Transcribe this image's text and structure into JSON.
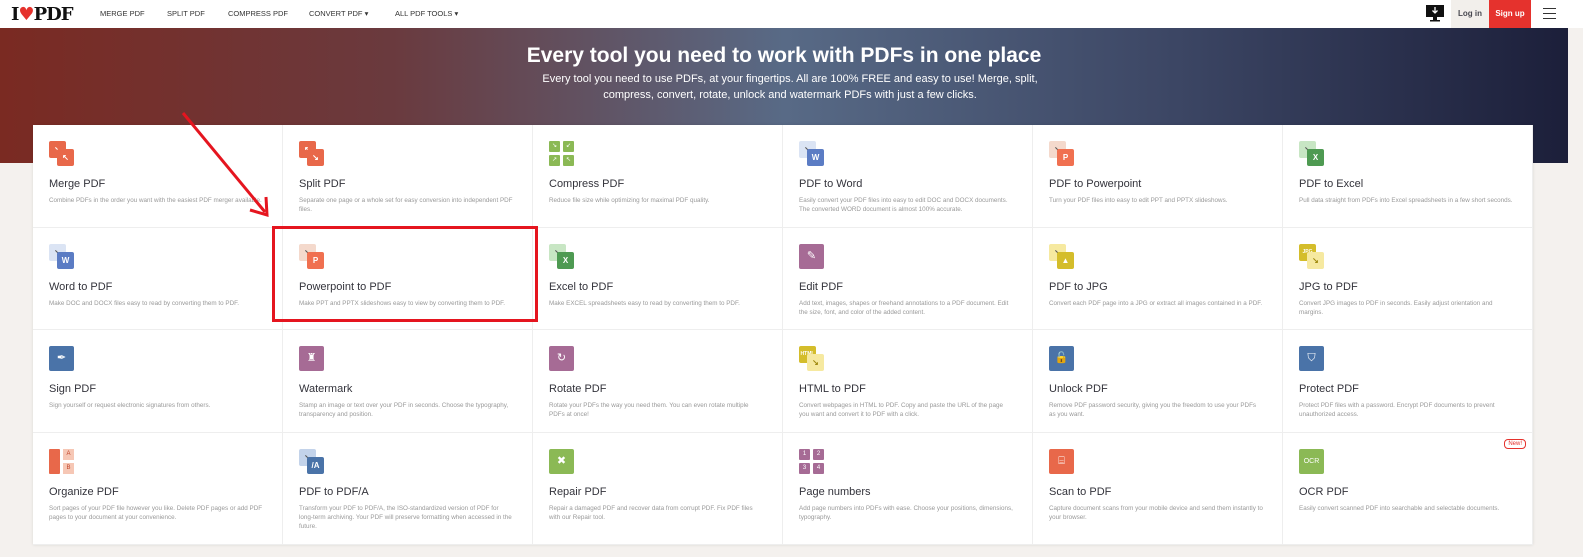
{
  "header": {
    "logo": "I♥PDF",
    "nav": [
      "MERGE PDF",
      "SPLIT PDF",
      "COMPRESS PDF",
      "CONVERT PDF ▾",
      "ALL PDF TOOLS ▾"
    ],
    "login": "Log in",
    "signup": "Sign up"
  },
  "hero": {
    "title": "Every tool you need to work with PDFs in one place",
    "subtitle": "Every tool you need to use PDFs, at your fingertips. All are 100% FREE and easy to use! Merge, split, compress, convert, rotate, unlock and watermark PDFs with just a few clicks."
  },
  "colors": {
    "accent": "#e5322d",
    "orange": "#e8684a",
    "green": "#8bb955",
    "blue": "#4a73a8",
    "purple": "#a66b95",
    "yellow": "#d9c233"
  },
  "tools": [
    {
      "title": "Merge PDF",
      "desc": "Combine PDFs in the order you want with the easiest PDF merger available.",
      "icon": "merge-icon"
    },
    {
      "title": "Split PDF",
      "desc": "Separate one page or a whole set for easy conversion into independent PDF files.",
      "icon": "split-icon"
    },
    {
      "title": "Compress PDF",
      "desc": "Reduce file size while optimizing for maximal PDF quality.",
      "icon": "compress-icon"
    },
    {
      "title": "PDF to Word",
      "desc": "Easily convert your PDF files into easy to edit DOC and DOCX documents. The converted WORD document is almost 100% accurate.",
      "icon": "word-icon",
      "glyph": "W"
    },
    {
      "title": "PDF to Powerpoint",
      "desc": "Turn your PDF files into easy to edit PPT and PPTX slideshows.",
      "icon": "powerpoint-icon",
      "glyph": "P"
    },
    {
      "title": "PDF to Excel",
      "desc": "Pull data straight from PDFs into Excel spreadsheets in a few short seconds.",
      "icon": "excel-icon",
      "glyph": "X"
    },
    {
      "title": "Word to PDF",
      "desc": "Make DOC and DOCX files easy to read by converting them to PDF.",
      "icon": "word-icon",
      "glyph": "W"
    },
    {
      "title": "Powerpoint to PDF",
      "desc": "Make PPT and PPTX slideshows easy to view by converting them to PDF.",
      "icon": "powerpoint-icon",
      "glyph": "P"
    },
    {
      "title": "Excel to PDF",
      "desc": "Make EXCEL spreadsheets easy to read by converting them to PDF.",
      "icon": "excel-icon",
      "glyph": "X"
    },
    {
      "title": "Edit PDF",
      "desc": "Add text, images, shapes or freehand annotations to a PDF document. Edit the size, font, and color of the added content.",
      "icon": "edit-icon",
      "glyph": "✎"
    },
    {
      "title": "PDF to JPG",
      "desc": "Convert each PDF page into a JPG or extract all images contained in a PDF.",
      "icon": "image-icon",
      "glyph": "▲"
    },
    {
      "title": "JPG to PDF",
      "desc": "Convert JPG images to PDF in seconds. Easily adjust orientation and margins.",
      "icon": "jpg-icon",
      "glyph": "JPG"
    },
    {
      "title": "Sign PDF",
      "desc": "Sign yourself or request electronic signatures from others.",
      "icon": "pen-icon",
      "glyph": "✒"
    },
    {
      "title": "Watermark",
      "desc": "Stamp an image or text over your PDF in seconds. Choose the typography, transparency and position.",
      "icon": "stamp-icon",
      "glyph": "♜"
    },
    {
      "title": "Rotate PDF",
      "desc": "Rotate your PDFs the way you need them. You can even rotate multiple PDFs at once!",
      "icon": "rotate-icon",
      "glyph": "↻"
    },
    {
      "title": "HTML to PDF",
      "desc": "Convert webpages in HTML to PDF. Copy and paste the URL of the page you want and convert it to PDF with a click.",
      "icon": "html-icon",
      "glyph": "HTML"
    },
    {
      "title": "Unlock PDF",
      "desc": "Remove PDF password security, giving you the freedom to use your PDFs as you want.",
      "icon": "unlock-icon",
      "glyph": "🔓"
    },
    {
      "title": "Protect PDF",
      "desc": "Protect PDF files with a password. Encrypt PDF documents to prevent unauthorized access.",
      "icon": "shield-icon",
      "glyph": "⛉"
    },
    {
      "title": "Organize PDF",
      "desc": "Sort pages of your PDF file however you like. Delete PDF pages or add PDF pages to your document at your convenience.",
      "icon": "organize-icon"
    },
    {
      "title": "PDF to PDF/A",
      "desc": "Transform your PDF to PDF/A, the ISO-standardized version of PDF for long-term archiving. Your PDF will preserve formatting when accessed in the future.",
      "icon": "pdfa-icon",
      "glyph": "/A"
    },
    {
      "title": "Repair PDF",
      "desc": "Repair a damaged PDF and recover data from corrupt PDF. Fix PDF files with our Repair tool.",
      "icon": "tools-icon",
      "glyph": "✖"
    },
    {
      "title": "Page numbers",
      "desc": "Add page numbers into PDFs with ease. Choose your positions, dimensions, typography.",
      "icon": "page-numbers-icon"
    },
    {
      "title": "Scan to PDF",
      "desc": "Capture document scans from your mobile device and send them instantly to your browser.",
      "icon": "scan-icon",
      "glyph": "⌸"
    },
    {
      "title": "OCR PDF",
      "desc": "Easily convert scanned PDF into searchable and selectable documents.",
      "icon": "ocr-icon",
      "glyph": "OCR",
      "badge": "New!"
    }
  ]
}
